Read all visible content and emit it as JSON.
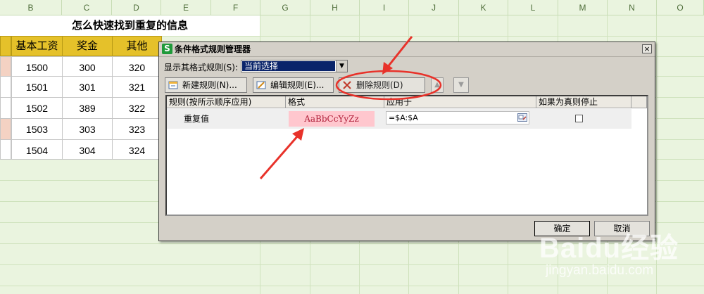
{
  "spreadsheet": {
    "columns": [
      "B",
      "C",
      "D",
      "E",
      "F",
      "G",
      "H",
      "I",
      "J",
      "K",
      "L",
      "M",
      "N",
      "O"
    ],
    "title": "怎么快速找到重复的信息",
    "headers": [
      "基本工资",
      "奖金",
      "其他"
    ],
    "rows": [
      [
        "1500",
        "300",
        "320"
      ],
      [
        "1501",
        "301",
        "321"
      ],
      [
        "1502",
        "389",
        "322"
      ],
      [
        "1503",
        "303",
        "323"
      ],
      [
        "1504",
        "304",
        "324"
      ]
    ]
  },
  "dialog": {
    "app_icon": "S",
    "title": "条件格式规则管理器",
    "close_label": "×",
    "show_rules_label": "显示其格式规则(S):",
    "show_rules_value": "当前选择",
    "toolbar": {
      "new_rule": "新建规则(N)...",
      "edit_rule": "编辑规则(E)...",
      "delete_rule": "删除规则(D)",
      "move_up": "▲",
      "move_down": "▼"
    },
    "columns": {
      "rule": "规则(按所示顺序应用)",
      "format": "格式",
      "applies_to": "应用于",
      "stop_if_true": "如果为真则停止"
    },
    "rule": {
      "name": "重复值",
      "format_preview": "AaBbCcYyZz",
      "applies_to": "=$A:$A",
      "stop_if_true": false
    },
    "ok_label": "确定",
    "cancel_label": "取消"
  },
  "annotation_color": "#e8322a",
  "watermark": {
    "logo": "Baidu经验",
    "url": "jingyan.baidu.com"
  }
}
